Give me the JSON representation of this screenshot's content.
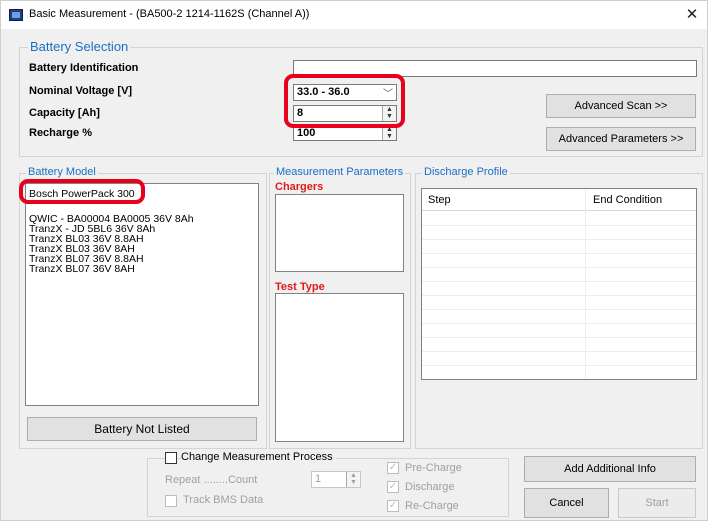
{
  "window": {
    "title": "Basic Measurement - (BA500-2 1214-1162S (Channel A))",
    "close_glyph": "✕"
  },
  "battery_selection": {
    "legend": "Battery Selection",
    "identification_label": "Battery Identification",
    "identification_value": "",
    "voltage_label": "Nominal Voltage [V]",
    "voltage_value": "33.0 - 36.0",
    "capacity_label": "Capacity [Ah]",
    "capacity_value": "8",
    "recharge_label": "Recharge %",
    "recharge_value": "100",
    "advanced_scan": "Advanced Scan >>",
    "advanced_parameters": "Advanced Parameters >>"
  },
  "battery_model": {
    "legend": "Battery Model",
    "items": [
      "Bosch PowerPack 300",
      "QWIC - BA00004 BA0005 36V  8Ah",
      "TranzX - JD 5BL6 36V 8Ah",
      "TranzX BL03 36V 8.8AH",
      "TranzX BL03 36V 8AH",
      "TranzX BL07 36V 8.8AH",
      "TranzX BL07 36V 8AH"
    ],
    "not_listed_button": "Battery Not Listed"
  },
  "measurement_parameters": {
    "legend": "Measurement Parameters",
    "chargers_title": "Chargers",
    "test_type_title": "Test Type"
  },
  "discharge_profile": {
    "legend": "Discharge Profile",
    "columns": [
      "Step",
      "End Condition"
    ]
  },
  "process": {
    "legend": "Change Measurement Process",
    "repeat_label": "Repeat ........Count",
    "repeat_value": "1",
    "track_bms": "Track BMS Data",
    "pre_charge": "Pre-Charge",
    "discharge": "Discharge",
    "re_charge": "Re-Charge"
  },
  "actions": {
    "add_info": "Add Additional Info",
    "cancel": "Cancel",
    "start": "Start"
  },
  "colors": {
    "accent_blue": "#1a6fc4",
    "highlight_red": "#e8001c",
    "section_red": "#e01b1b"
  }
}
